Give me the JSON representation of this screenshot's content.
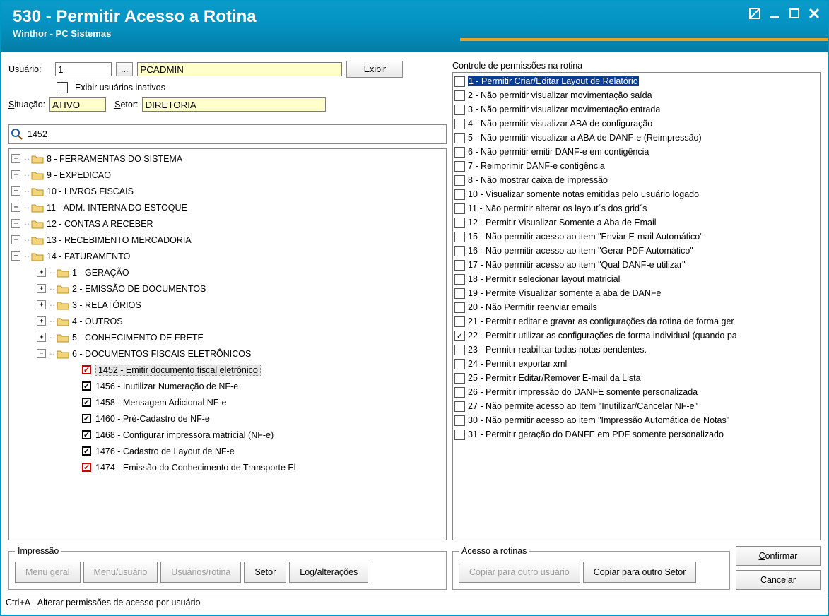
{
  "window": {
    "title": "530 - Permitir Acesso a Rotina",
    "subtitle": "Winthor - PC Sistemas"
  },
  "user": {
    "label": "Usuário:",
    "id": "1",
    "name": "PCADMIN",
    "show_btn": "Exibir",
    "inactive_label": "Exibir usuários inativos"
  },
  "status": {
    "label_sit": "Situação:",
    "value_sit": "ATIVO",
    "label_setor": "Setor:",
    "value_setor": "DIRETORIA"
  },
  "search": {
    "value": "1452"
  },
  "tree": {
    "items": [
      {
        "depth": 0,
        "exp": "+",
        "type": "folder",
        "label": "8 - FERRAMENTAS DO SISTEMA"
      },
      {
        "depth": 0,
        "exp": "+",
        "type": "folder",
        "label": "9 - EXPEDICAO"
      },
      {
        "depth": 0,
        "exp": "+",
        "type": "folder",
        "label": "10 - LIVROS FISCAIS"
      },
      {
        "depth": 0,
        "exp": "+",
        "type": "folder",
        "label": "11 - ADM. INTERNA DO ESTOQUE"
      },
      {
        "depth": 0,
        "exp": "+",
        "type": "folder",
        "label": "12 - CONTAS A RECEBER"
      },
      {
        "depth": 0,
        "exp": "+",
        "type": "folder",
        "label": "13 - RECEBIMENTO MERCADORIA"
      },
      {
        "depth": 0,
        "exp": "-",
        "type": "folder",
        "label": "14 - FATURAMENTO"
      },
      {
        "depth": 1,
        "exp": "+",
        "type": "folder",
        "label": "1 - GERAÇÃO"
      },
      {
        "depth": 1,
        "exp": "+",
        "type": "folder",
        "label": "2 - EMISSÃO DE DOCUMENTOS"
      },
      {
        "depth": 1,
        "exp": "+",
        "type": "folder",
        "label": "3 - RELATÓRIOS"
      },
      {
        "depth": 1,
        "exp": "+",
        "type": "folder",
        "label": "4 - OUTROS"
      },
      {
        "depth": 1,
        "exp": "+",
        "type": "folder",
        "label": "5 - CONHECIMENTO DE FRETE"
      },
      {
        "depth": 1,
        "exp": "-",
        "type": "folder",
        "label": "6 - DOCUMENTOS FISCAIS ELETRÔNICOS"
      },
      {
        "depth": 2,
        "exp": "",
        "type": "leaf",
        "chk": "red",
        "label": "1452 - Emitir documento fiscal eletrônico",
        "selected": true
      },
      {
        "depth": 2,
        "exp": "",
        "type": "leaf",
        "chk": "black",
        "label": "1456 - Inutilizar Numeração de NF-e"
      },
      {
        "depth": 2,
        "exp": "",
        "type": "leaf",
        "chk": "black",
        "label": "1458 - Mensagem Adicional NF-e"
      },
      {
        "depth": 2,
        "exp": "",
        "type": "leaf",
        "chk": "black",
        "label": "1460 - Pré-Cadastro de NF-e"
      },
      {
        "depth": 2,
        "exp": "",
        "type": "leaf",
        "chk": "black",
        "label": "1468 - Configurar impressora matricial (NF-e)"
      },
      {
        "depth": 2,
        "exp": "",
        "type": "leaf",
        "chk": "black",
        "label": "1476 - Cadastro de Layout de NF-e"
      },
      {
        "depth": 2,
        "exp": "",
        "type": "leaf",
        "chk": "red",
        "label": "1474 - Emissão do Conhecimento de Transporte El"
      }
    ]
  },
  "permissions": {
    "title": "Controle de permissões na rotina",
    "items": [
      {
        "checked": false,
        "label": "1 - Permitir Criar/Editar Layout de Relatório",
        "selected": true
      },
      {
        "checked": false,
        "label": "2 - Não permitir visualizar movimentação saída"
      },
      {
        "checked": false,
        "label": "3 - Não permitir visualizar movimentação entrada"
      },
      {
        "checked": false,
        "label": "4 - Não permitir visualizar ABA de configuração"
      },
      {
        "checked": false,
        "label": "5 - Não permitir visualizar a ABA de DANF-e (Reimpressão)"
      },
      {
        "checked": false,
        "label": "6 - Não permitir emitir DANF-e em contigência"
      },
      {
        "checked": false,
        "label": "7 - Reimprimir DANF-e contigência"
      },
      {
        "checked": false,
        "label": "8 - Não mostrar caixa de impressão"
      },
      {
        "checked": false,
        "label": "10 - Visualizar somente notas emitidas pelo usuário logado"
      },
      {
        "checked": false,
        "label": "11 - Não permitir alterar os layout´s dos grid´s"
      },
      {
        "checked": false,
        "label": "12 - Permitir Visualizar Somente a Aba de Email"
      },
      {
        "checked": false,
        "label": "15 - Não permitir acesso ao item \"Enviar E-mail Automático\""
      },
      {
        "checked": false,
        "label": "16 - Não permitir acesso ao item \"Gerar PDF Automático\""
      },
      {
        "checked": false,
        "label": "17 - Não permitir acesso ao item \"Qual DANF-e utilizar\""
      },
      {
        "checked": false,
        "label": "18 - Permitir selecionar layout matricial"
      },
      {
        "checked": false,
        "label": "19 - Permite Visualizar somente a aba de DANFe"
      },
      {
        "checked": false,
        "label": "20 - Não Permitir reenviar emails"
      },
      {
        "checked": false,
        "label": "21 - Permitir editar e gravar as configurações da rotina de forma ger"
      },
      {
        "checked": true,
        "label": "22 - Permitir utilizar as configurações de forma individual (quando pa"
      },
      {
        "checked": false,
        "label": "23 - Permitir reabilitar todas notas pendentes."
      },
      {
        "checked": false,
        "label": "24 - Permitir exportar xml"
      },
      {
        "checked": false,
        "label": "25 - Permitir Editar/Remover E-mail da Lista"
      },
      {
        "checked": false,
        "label": "26 - Permitir impressão do DANFE somente personalizada"
      },
      {
        "checked": false,
        "label": "27 - Não permite acesso ao Item \"Inutilizar/Cancelar NF-e\""
      },
      {
        "checked": false,
        "label": "30 - Não permitir acesso ao item \"Impressão Automática de Notas\""
      },
      {
        "checked": false,
        "label": "31 - Permitir geração do DANFE em PDF somente personalizado"
      }
    ]
  },
  "impressao": {
    "legend": "Impressão",
    "btns": [
      "Menu geral",
      "Menu/usuário",
      "Usuários/rotina",
      "Setor",
      "Log/alterações"
    ],
    "disabled": [
      true,
      true,
      true,
      false,
      false
    ]
  },
  "acesso": {
    "legend": "Acesso a rotinas",
    "btns": [
      "Copiar para outro usuário",
      "Copiar para outro Setor"
    ],
    "disabled": [
      true,
      false
    ]
  },
  "actions": {
    "confirm": "Confirmar",
    "cancel": "Cancelar"
  },
  "status_bar": "Ctrl+A - Alterar permissões de acesso por usuário"
}
